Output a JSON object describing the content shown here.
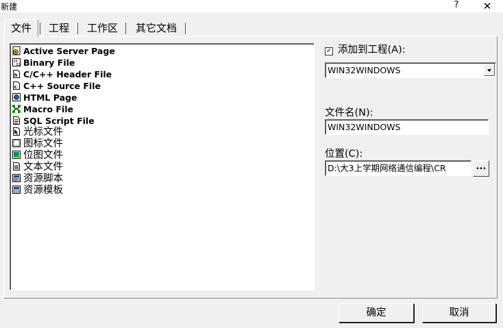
{
  "window": {
    "title": "新建",
    "help": "?",
    "close": "✕"
  },
  "tabs": [
    {
      "label": "文件"
    },
    {
      "label": "工程"
    },
    {
      "label": "工作区"
    },
    {
      "label": "其它文档"
    }
  ],
  "file_types": [
    {
      "label": "Active Server Page",
      "icon": "asp-file-icon"
    },
    {
      "label": "Binary File",
      "icon": "binary-file-icon"
    },
    {
      "label": "C/C++ Header File",
      "icon": "header-file-icon"
    },
    {
      "label": "C++ Source File",
      "icon": "source-file-icon"
    },
    {
      "label": "HTML Page",
      "icon": "html-page-icon"
    },
    {
      "label": "Macro File",
      "icon": "macro-file-icon"
    },
    {
      "label": "SQL Script File",
      "icon": "sql-file-icon"
    },
    {
      "label": "光标文件",
      "icon": "cursor-file-icon"
    },
    {
      "label": "图标文件",
      "icon": "icon-file-icon"
    },
    {
      "label": "位图文件",
      "icon": "bitmap-file-icon"
    },
    {
      "label": "文本文件",
      "icon": "text-file-icon"
    },
    {
      "label": "资源脚本",
      "icon": "resource-script-icon"
    },
    {
      "label": "资源模板",
      "icon": "resource-template-icon"
    }
  ],
  "add_to_project": {
    "label": "添加到工程(A):",
    "checked": true,
    "project": "WIN32WINDOWS"
  },
  "filename": {
    "label": "文件名(N):",
    "value": "WIN32WINDOWS"
  },
  "location": {
    "label": "位置(C):",
    "value": "D:\\大3上学期网络通信编程\\CR",
    "browse": "..."
  },
  "buttons": {
    "ok": "确定",
    "cancel": "取消"
  }
}
